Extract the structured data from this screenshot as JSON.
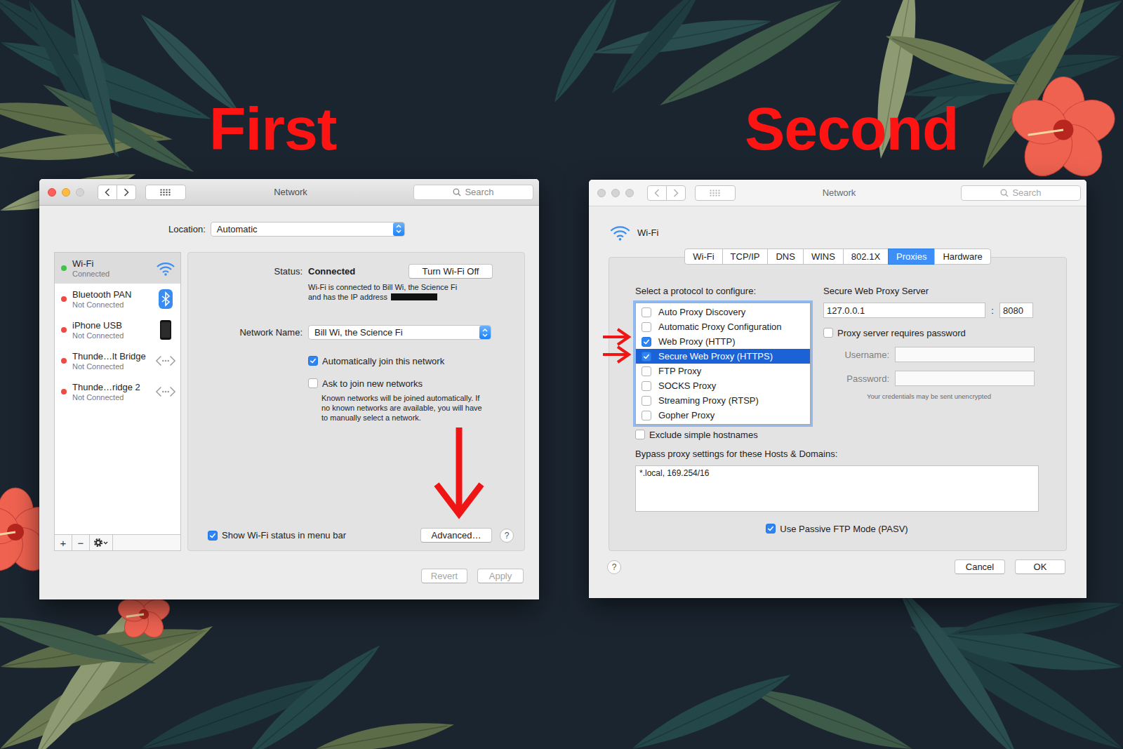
{
  "headings": {
    "first": "First",
    "second": "Second"
  },
  "first_window": {
    "title": "Network",
    "active": true,
    "zoom_enabled": false,
    "search_placeholder": "Search",
    "location": {
      "label": "Location:",
      "value": "Automatic"
    },
    "services": [
      {
        "name": "Wi-Fi",
        "status": "Connected",
        "color": "#3ec547",
        "selected": true,
        "kind": "wifi"
      },
      {
        "name": "Bluetooth PAN",
        "status": "Not Connected",
        "color": "#f04b43",
        "selected": false,
        "kind": "bluetooth"
      },
      {
        "name": "iPhone USB",
        "status": "Not Connected",
        "color": "#f04b43",
        "selected": false,
        "kind": "phone"
      },
      {
        "name": "Thunde…lt Bridge",
        "status": "Not Connected",
        "color": "#f04b43",
        "selected": false,
        "kind": "thunderbolt"
      },
      {
        "name": "Thunde…ridge 2",
        "status": "Not Connected",
        "color": "#f04b43",
        "selected": false,
        "kind": "thunderbolt"
      }
    ],
    "toolbar": {
      "add": "+",
      "remove": "−"
    },
    "status": {
      "label": "Status:",
      "value": "Connected",
      "button": "Turn Wi-Fi Off",
      "detail_lines": [
        "Wi-Fi is connected to Bill Wi, the Science Fi",
        "and has the IP address"
      ],
      "ip_redacted": true
    },
    "network_name": {
      "label": "Network Name:",
      "value": "Bill Wi, the Science Fi"
    },
    "options": [
      {
        "label": "Automatically join this network",
        "checked": true
      },
      {
        "label": "Ask to join new networks",
        "checked": false
      }
    ],
    "hint_lines": [
      "Known networks will be joined automatically. If",
      "no known networks are available, you will have",
      "to manually select a network."
    ],
    "show_status": {
      "label": "Show Wi-Fi status in menu bar",
      "checked": true
    },
    "advanced_button": "Advanced…",
    "help": "?",
    "footer_buttons": [
      {
        "label": "Revert",
        "disabled": true
      },
      {
        "label": "Apply",
        "disabled": true
      }
    ]
  },
  "second_window": {
    "title": "Network",
    "active": false,
    "zoom_enabled": false,
    "search_placeholder": "Search",
    "service": "Wi-Fi",
    "tabs": [
      {
        "label": "Wi-Fi",
        "selected": false
      },
      {
        "label": "TCP/IP",
        "selected": false
      },
      {
        "label": "DNS",
        "selected": false
      },
      {
        "label": "WINS",
        "selected": false
      },
      {
        "label": "802.1X",
        "selected": false
      },
      {
        "label": "Proxies",
        "selected": true
      },
      {
        "label": "Hardware",
        "selected": false
      }
    ],
    "protocol_prompt": "Select a protocol to configure:",
    "protocols": [
      {
        "label": "Auto Proxy Discovery",
        "checked": false,
        "selected": false
      },
      {
        "label": "Automatic Proxy Configuration",
        "checked": false,
        "selected": false
      },
      {
        "label": "Web Proxy (HTTP)",
        "checked": true,
        "selected": false
      },
      {
        "label": "Secure Web Proxy (HTTPS)",
        "checked": true,
        "selected": true
      },
      {
        "label": "FTP Proxy",
        "checked": false,
        "selected": false
      },
      {
        "label": "SOCKS Proxy",
        "checked": false,
        "selected": false
      },
      {
        "label": "Streaming Proxy (RTSP)",
        "checked": false,
        "selected": false
      },
      {
        "label": "Gopher Proxy",
        "checked": false,
        "selected": false
      }
    ],
    "server": {
      "title": "Secure Web Proxy Server",
      "host": "127.0.0.1",
      "separator": ":",
      "port": "8080"
    },
    "requires_password": {
      "label": "Proxy server requires password",
      "checked": false
    },
    "credentials": [
      {
        "label": "Username:",
        "value": "",
        "disabled": true
      },
      {
        "label": "Password:",
        "value": "",
        "disabled": true
      }
    ],
    "credentials_note": "Your credentials may be sent unencrypted",
    "exclude_simple": {
      "label": "Exclude simple hostnames",
      "checked": false
    },
    "bypass": {
      "label": "Bypass proxy settings for these Hosts & Domains:",
      "value": "*.local, 169.254/16"
    },
    "passive_ftp": {
      "label": "Use Passive FTP Mode (PASV)",
      "checked": true
    },
    "help": "?",
    "buttons": [
      {
        "label": "Cancel"
      },
      {
        "label": "OK"
      }
    ]
  }
}
